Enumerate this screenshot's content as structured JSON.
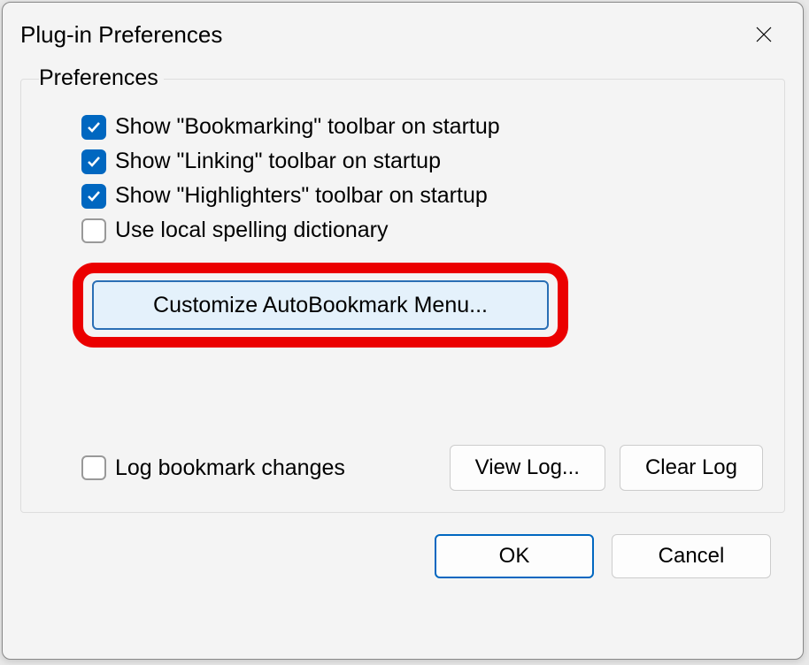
{
  "dialog": {
    "title": "Plug-in Preferences",
    "fieldset_label": "Preferences",
    "checkboxes": [
      {
        "label": "Show \"Bookmarking\" toolbar on startup",
        "checked": true
      },
      {
        "label": "Show \"Linking\" toolbar on startup",
        "checked": true
      },
      {
        "label": "Show \"Highlighters\" toolbar on startup",
        "checked": true
      },
      {
        "label": "Use local spelling dictionary",
        "checked": false
      }
    ],
    "customize_button": "Customize AutoBookmark Menu...",
    "log_checkbox": {
      "label": "Log bookmark changes",
      "checked": false
    },
    "view_log_button": "View Log...",
    "clear_log_button": "Clear Log",
    "ok_button": "OK",
    "cancel_button": "Cancel"
  },
  "highlight": {
    "color": "#eb0000"
  }
}
